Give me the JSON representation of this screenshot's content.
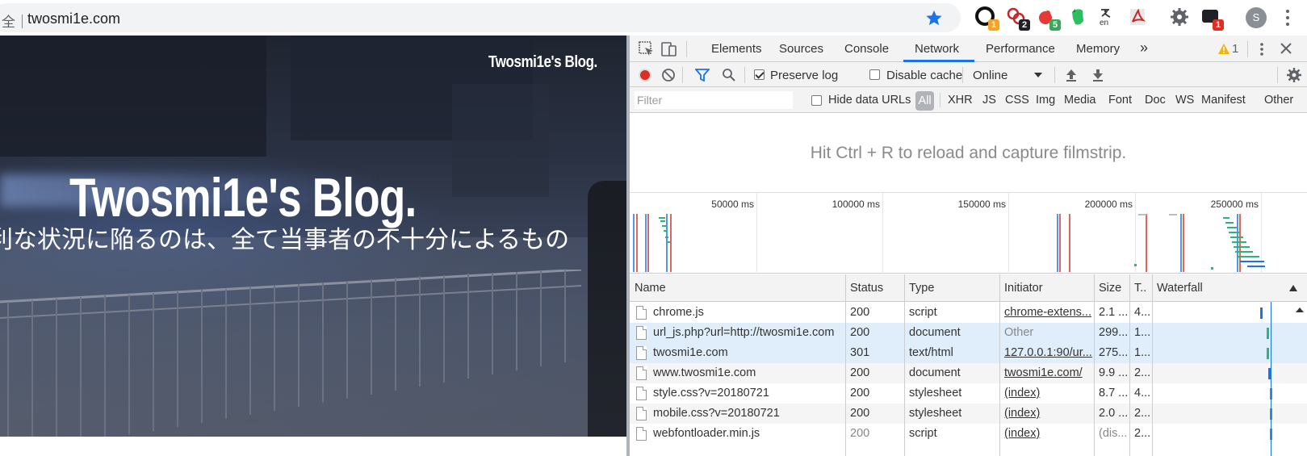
{
  "browser": {
    "omnibox_prefix": "全｜",
    "url": "twosmi1e.com",
    "extensions": [
      {
        "icon": "ext-circle-icon",
        "badge": "1",
        "badge_color": "#f4a324"
      },
      {
        "icon": "ext-links-icon",
        "badge": "2",
        "badge_color": "#202124"
      },
      {
        "icon": "ext-fruit-icon",
        "badge": "5",
        "badge_color": "#3aa757"
      },
      {
        "icon": "evernote-icon",
        "badge": "",
        "badge_color": ""
      },
      {
        "icon": "translate-icon",
        "badge": "",
        "badge_color": ""
      },
      {
        "icon": "pdf-icon",
        "badge": "",
        "badge_color": ""
      },
      {
        "icon": "gear-extension-icon",
        "badge": "",
        "badge_color": ""
      },
      {
        "icon": "ext-dark-icon",
        "badge": "1",
        "badge_color": "#d93025"
      }
    ],
    "translate_label": "en",
    "avatar_letter": "S"
  },
  "page": {
    "small_title": "Twosmi1e's Blog.",
    "title": "Twosmi1e's Blog.",
    "subtitle": "利な状況に陥るのは、全て当事者の不十分によるもの"
  },
  "devtools": {
    "tabs": [
      {
        "label": "Elements",
        "active": false
      },
      {
        "label": "Sources",
        "active": false
      },
      {
        "label": "Console",
        "active": false
      },
      {
        "label": "Network",
        "active": true
      },
      {
        "label": "Performance",
        "active": false
      },
      {
        "label": "Memory",
        "active": false
      }
    ],
    "more_tabs": "»",
    "warning_count": "1",
    "toolbar": {
      "preserve_log": "Preserve log",
      "preserve_log_checked": true,
      "disable_cache": "Disable cache",
      "disable_cache_checked": false,
      "throttling": "Online"
    },
    "filter": {
      "placeholder": "Filter",
      "hide_data_urls": "Hide data URLs",
      "types": [
        "All",
        "XHR",
        "JS",
        "CSS",
        "Img",
        "Media",
        "Font",
        "Doc",
        "WS",
        "Manifest",
        "Other"
      ],
      "active_type": "All"
    },
    "filmstrip_message": "Hit Ctrl + R to reload and capture filmstrip.",
    "overview_ticks": [
      "50000 ms",
      "100000 ms",
      "150000 ms",
      "200000 ms",
      "250000 ms"
    ],
    "columns": [
      "Name",
      "Status",
      "Type",
      "Initiator",
      "Size",
      "T..",
      "Waterfall"
    ],
    "rows": [
      {
        "name": "chrome.js",
        "status": "200",
        "type": "script",
        "initiator": "chrome-extens...",
        "initiator_link": true,
        "size": "2.1 ...",
        "time": "4...",
        "state": "normal",
        "wf_color": "#1a73e8"
      },
      {
        "name": "url_js.php?url=http://twosmi1e.com",
        "status": "200",
        "type": "document",
        "initiator": "Other",
        "initiator_link": false,
        "size": "299...",
        "time": "1...",
        "state": "selected",
        "wf_color": "#2ab57d"
      },
      {
        "name": "twosmi1e.com",
        "status": "301",
        "type": "text/html",
        "initiator": "127.0.0.1:90/ur...",
        "initiator_link": true,
        "size": "275...",
        "time": "1...",
        "state": "selected",
        "wf_color": "#2ab57d"
      },
      {
        "name": "www.twosmi1e.com",
        "status": "200",
        "type": "document",
        "initiator": "twosmi1e.com/",
        "initiator_link": true,
        "size": "9.9 ...",
        "time": "2...",
        "state": "alt",
        "wf_color": "#1a73e8"
      },
      {
        "name": "style.css?v=20180721",
        "status": "200",
        "type": "stylesheet",
        "initiator": "(index)",
        "initiator_link": true,
        "size": "8.7 ...",
        "time": "4...",
        "state": "normal",
        "wf_color": "#2ab57d"
      },
      {
        "name": "mobile.css?v=20180721",
        "status": "200",
        "type": "stylesheet",
        "initiator": "(index)",
        "initiator_link": true,
        "size": "2.0 ...",
        "time": "2...",
        "state": "alt",
        "wf_color": "#2ab57d"
      },
      {
        "name": "webfontloader.min.js",
        "status": "200",
        "type": "script",
        "initiator": "(index)",
        "initiator_link": true,
        "size": "(dis...",
        "time": "2...",
        "state": "muted",
        "wf_color": "#2ab57d"
      }
    ]
  }
}
